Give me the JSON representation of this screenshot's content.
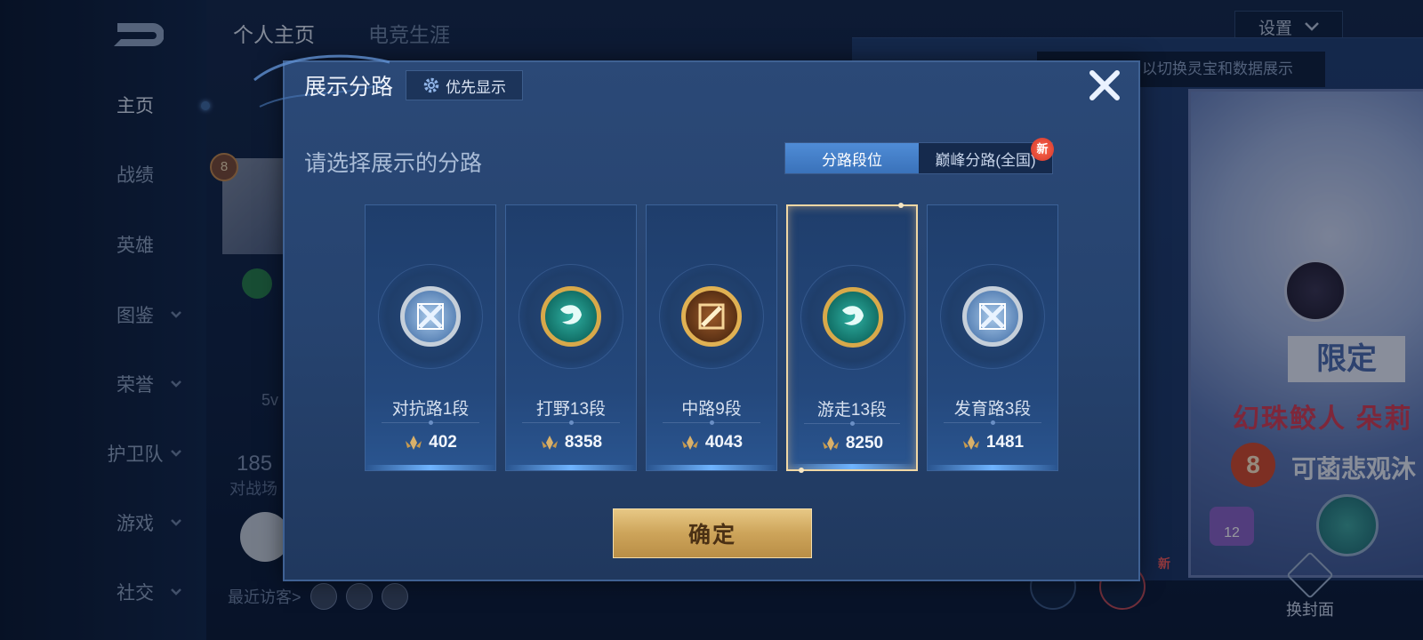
{
  "nav": {
    "items": [
      {
        "label": "主页",
        "active": true,
        "chevron": false
      },
      {
        "label": "战绩",
        "active": false,
        "chevron": false
      },
      {
        "label": "英雄",
        "active": false,
        "chevron": false
      },
      {
        "label": "图鉴",
        "active": false,
        "chevron": true
      },
      {
        "label": "荣誉",
        "active": false,
        "chevron": true
      },
      {
        "label": "护卫队",
        "active": false,
        "chevron": true
      },
      {
        "label": "游戏",
        "active": false,
        "chevron": true
      },
      {
        "label": "社交",
        "active": false,
        "chevron": true
      }
    ]
  },
  "top_tabs": [
    "个人主页",
    "电竞生涯"
  ],
  "settings_label": "设置",
  "hint_text": "以切换灵宝和数据展示",
  "profile": {
    "level_badge": "8",
    "partial_text": "5v",
    "stat_value": "185",
    "stat_label": "对战场",
    "recent_visitors_label": "最近访客>"
  },
  "cover": {
    "limit_label": "限定",
    "title": "幻珠鲛人 朵莉",
    "level": "8",
    "name": "可菡悲观沐",
    "badge_count": "12",
    "swap_cover_label": "换封面",
    "new_tag": "新"
  },
  "modal": {
    "title": "展示分路",
    "priority_label": "优先显示",
    "subtitle": "请选择展示的分路",
    "segments": [
      {
        "label": "分路段位",
        "selected": true
      },
      {
        "label": "巅峰分路(全国)",
        "selected": false,
        "new_badge": "新"
      }
    ],
    "lanes": [
      {
        "label": "对抗路1段",
        "score": "402",
        "emblem": "silver",
        "selected": false
      },
      {
        "label": "打野13段",
        "score": "8358",
        "emblem": "gold-teal",
        "selected": false
      },
      {
        "label": "中路9段",
        "score": "4043",
        "emblem": "gold-brown",
        "selected": false
      },
      {
        "label": "游走13段",
        "score": "8250",
        "emblem": "gold-teal",
        "selected": true
      },
      {
        "label": "发育路3段",
        "score": "1481",
        "emblem": "silver",
        "selected": false
      }
    ],
    "confirm_label": "确定"
  },
  "colors": {
    "accent_blue": "#4f8cd6",
    "gold": "#d8b06a",
    "modal_bg": "#2b4977"
  }
}
